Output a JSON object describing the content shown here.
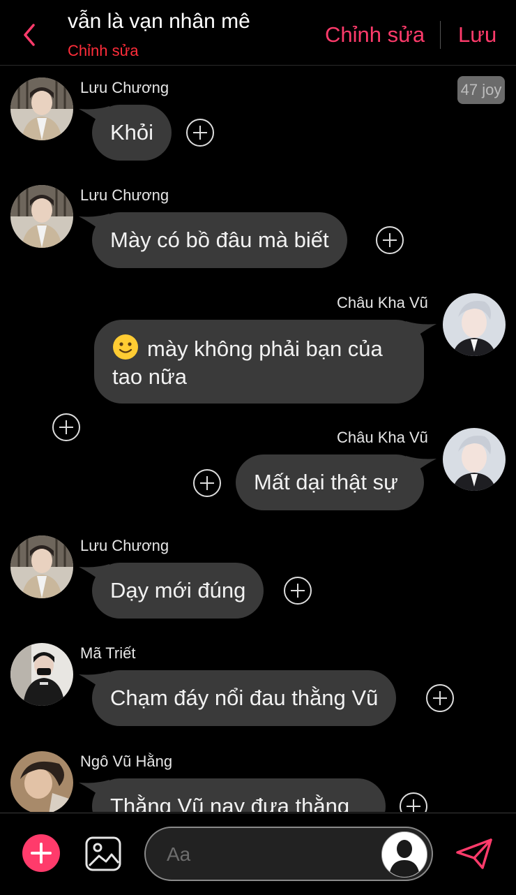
{
  "header": {
    "title": "vẫn là vạn nhân mê",
    "subtitle": "Chỉnh sửa",
    "edit_label": "Chỉnh sửa",
    "save_label": "Lưu"
  },
  "badge": "47 joy",
  "messages": [
    {
      "sender": "Lưu Chương",
      "text": "Khỏi",
      "side": "left"
    },
    {
      "sender": "Lưu Chương",
      "text": "Mày có bồ đâu mà biết",
      "side": "left"
    },
    {
      "sender": "Châu Kha Vũ",
      "text": "mày không phải bạn của tao nữa",
      "emoji": "slightly-smiling-face",
      "side": "right"
    },
    {
      "sender": "Châu Kha Vũ",
      "text": "Mất dại thật sự",
      "side": "right"
    },
    {
      "sender": "Lưu Chương",
      "text": "Dạy mới đúng",
      "side": "left"
    },
    {
      "sender": "Mã Triết",
      "text": "Chạm đáy nổi đau thằng Vũ",
      "side": "left"
    },
    {
      "sender": "Ngô Vũ Hằng",
      "text": "Thằng Vũ nay đưa thằng",
      "side": "left"
    }
  ],
  "composer": {
    "placeholder": "Aa"
  },
  "colors": {
    "accent": "#ff3b6b",
    "subtitle": "#ff2d3a",
    "bubble": "#3a3a3a",
    "background": "#000000"
  },
  "icons": [
    "back-chevron-icon",
    "plus-circle-icon",
    "add-icon",
    "image-icon",
    "send-icon",
    "user-silhouette-icon"
  ]
}
